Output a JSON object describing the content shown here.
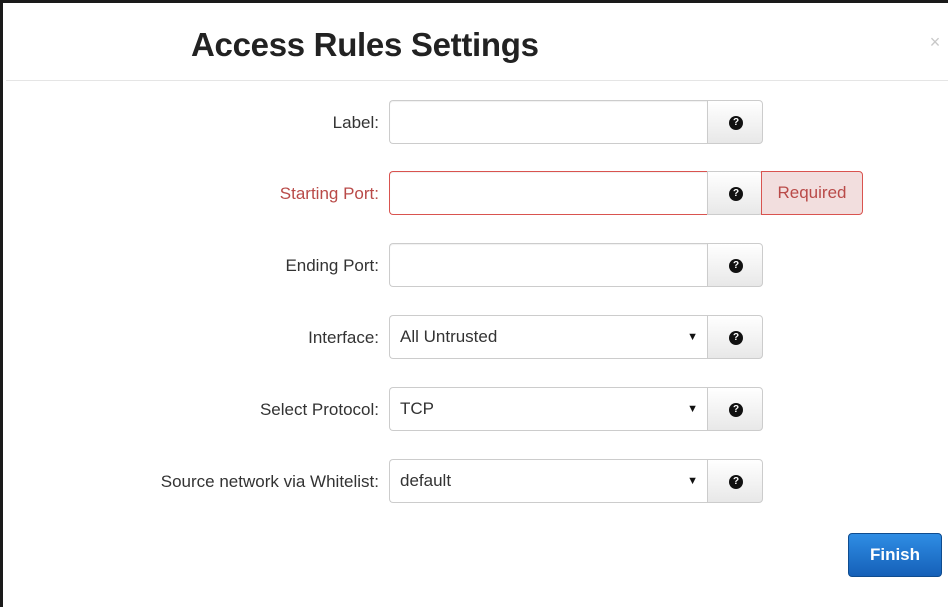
{
  "dialog": {
    "title": "Access Rules Settings",
    "close_label": "×"
  },
  "form": {
    "label": {
      "label": "Label:",
      "value": "",
      "help_icon": "question-circle-icon"
    },
    "starting_port": {
      "label": "Starting Port:",
      "value": "",
      "help_icon": "question-circle-icon",
      "error_text": "Required"
    },
    "ending_port": {
      "label": "Ending Port:",
      "value": "",
      "help_icon": "question-circle-icon"
    },
    "interface": {
      "label": "Interface:",
      "selected": "All Untrusted",
      "help_icon": "question-circle-icon"
    },
    "protocol": {
      "label": "Select Protocol:",
      "selected": "TCP",
      "help_icon": "question-circle-icon"
    },
    "whitelist": {
      "label": "Source network via Whitelist:",
      "selected": "default",
      "help_icon": "question-circle-icon"
    }
  },
  "footer": {
    "finish_label": "Finish"
  },
  "colors": {
    "error_text": "#b94a48",
    "error_border": "#d9534f",
    "error_bg": "#f2dede",
    "primary_button": "#1f74d0"
  }
}
